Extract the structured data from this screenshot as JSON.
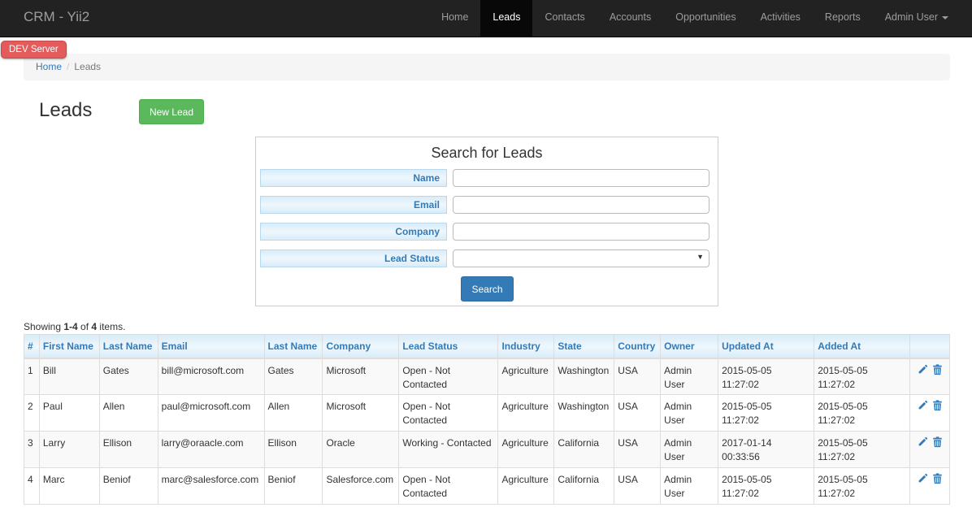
{
  "app": {
    "brand": "CRM - Yii2",
    "dev_badge": "DEV  Server"
  },
  "nav": {
    "items": [
      {
        "label": "Home"
      },
      {
        "label": "Leads",
        "active": true
      },
      {
        "label": "Contacts"
      },
      {
        "label": "Accounts"
      },
      {
        "label": "Opportunities"
      },
      {
        "label": "Activities"
      },
      {
        "label": "Reports"
      },
      {
        "label": "Admin User",
        "dropdown": true,
        "icon": "caret-down-icon"
      }
    ]
  },
  "breadcrumb": {
    "home": "Home",
    "separator": "/",
    "current": "Leads"
  },
  "page": {
    "title": "Leads",
    "new_button": "New Lead"
  },
  "search": {
    "title": "Search for Leads",
    "fields": [
      {
        "label": "Name",
        "value": ""
      },
      {
        "label": "Email",
        "value": ""
      },
      {
        "label": "Company",
        "value": ""
      },
      {
        "label": "Lead Status",
        "value": "",
        "type": "select"
      }
    ],
    "submit": "Search"
  },
  "summary": {
    "prefix": "Showing ",
    "range": "1-4",
    "of": " of ",
    "total": "4",
    "suffix": " items."
  },
  "grid": {
    "headers": [
      "#",
      "First Name",
      "Last Name",
      "Email",
      "Last Name",
      "Company",
      "Lead Status",
      "Industry",
      "State",
      "Country",
      "Owner",
      "Updated At",
      "Added At",
      ""
    ],
    "rows": [
      {
        "num": "1",
        "first": "Bill",
        "last": "Gates",
        "email": "bill@microsoft.com",
        "last2": "Gates",
        "company": "Microsoft",
        "status": "Open - Not Contacted",
        "industry": "Agriculture",
        "state": "Washington",
        "country": "USA",
        "owner": "Admin User",
        "updated": "2015-05-05 11:27:02",
        "added": "2015-05-05 11:27:02"
      },
      {
        "num": "2",
        "first": "Paul",
        "last": "Allen",
        "email": "paul@microsoft.com",
        "last2": "Allen",
        "company": "Microsoft",
        "status": "Open - Not Contacted",
        "industry": "Agriculture",
        "state": "Washington",
        "country": "USA",
        "owner": "Admin User",
        "updated": "2015-05-05 11:27:02",
        "added": "2015-05-05 11:27:02"
      },
      {
        "num": "3",
        "first": "Larry",
        "last": "Ellison",
        "email": "larry@oraacle.com",
        "last2": "Ellison",
        "company": "Oracle",
        "status": "Working - Contacted",
        "industry": "Agriculture",
        "state": "California",
        "country": "USA",
        "owner": "Admin User",
        "updated": "2017-01-14 00:33:56",
        "added": "2015-05-05 11:27:02"
      },
      {
        "num": "4",
        "first": "Marc",
        "last": "Beniof",
        "email": "marc@salesforce.com",
        "last2": "Beniof",
        "company": "Salesforce.com",
        "status": "Open - Not Contacted",
        "industry": "Agriculture",
        "state": "California",
        "country": "USA",
        "owner": "Admin User",
        "updated": "2015-05-05 11:27:02",
        "added": "2015-05-05 11:27:02"
      }
    ],
    "row_actions": [
      "pencil-icon",
      "trash-icon"
    ]
  },
  "colors": {
    "navbar": "#222222",
    "link": "#337ab7",
    "success": "#5cb85c",
    "primary": "#337ab7",
    "dev_badge": "#e35b5b"
  }
}
